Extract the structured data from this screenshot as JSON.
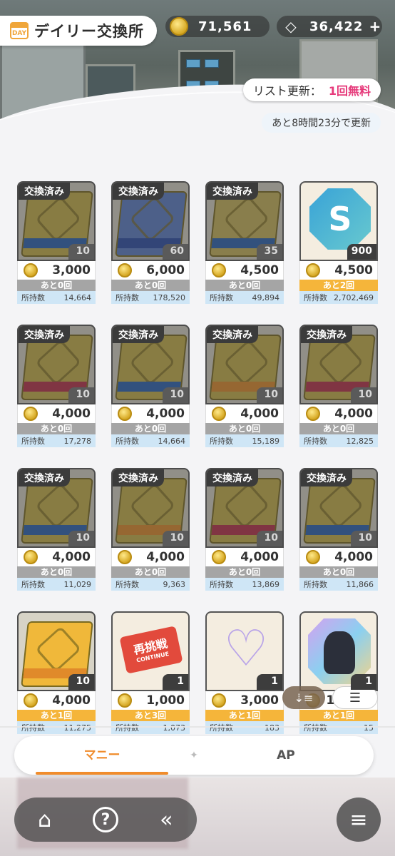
{
  "header": {
    "title": "デイリー交換所",
    "day_icon_label": "DAY",
    "coins": "71,561",
    "gems": "36,422",
    "gems_plus": "+",
    "refresh_label": "リスト更新：",
    "refresh_value": "1回無料",
    "timer": "あと8時間23分で更新"
  },
  "labels": {
    "done_badge": "交換済み",
    "own_label": "所持数"
  },
  "items": [
    {
      "kind": "book",
      "count": "10",
      "price": "3,000",
      "remain": "あと0回",
      "owned": "14,664",
      "done": true,
      "color": "#c7b14a",
      "band": "#2b63b4"
    },
    {
      "kind": "book",
      "count": "60",
      "price": "6,000",
      "remain": "あと0回",
      "owned": "178,520",
      "done": true,
      "color": "#5b7ec9",
      "band": "#2b4ea8"
    },
    {
      "kind": "book",
      "count": "35",
      "price": "4,500",
      "remain": "あと0回",
      "owned": "49,894",
      "done": true,
      "color": "#c9b559",
      "band": "#2a63b2"
    },
    {
      "kind": "special-s",
      "count": "900",
      "price": "4,500",
      "remain": "あと2回",
      "owned": "2,702,469",
      "done": false,
      "icon_text": "S"
    },
    {
      "kind": "book",
      "count": "10",
      "price": "4,000",
      "remain": "あと0回",
      "owned": "17,278",
      "done": true,
      "color": "#c7b14a",
      "band": "#b8304a"
    },
    {
      "kind": "book",
      "count": "10",
      "price": "4,000",
      "remain": "あと0回",
      "owned": "14,664",
      "done": true,
      "color": "#c7b14a",
      "band": "#2b63b4"
    },
    {
      "kind": "book",
      "count": "10",
      "price": "4,000",
      "remain": "あと0回",
      "owned": "15,189",
      "done": true,
      "color": "#c7b14a",
      "band": "#e08a2a"
    },
    {
      "kind": "book",
      "count": "10",
      "price": "4,000",
      "remain": "あと0回",
      "owned": "12,825",
      "done": true,
      "color": "#c7b14a",
      "band": "#b8304a"
    },
    {
      "kind": "book",
      "count": "10",
      "price": "4,000",
      "remain": "あと0回",
      "owned": "11,029",
      "done": true,
      "color": "#c7b14a",
      "band": "#2b63b4"
    },
    {
      "kind": "book",
      "count": "10",
      "price": "4,000",
      "remain": "あと0回",
      "owned": "9,363",
      "done": true,
      "color": "#c7b14a",
      "band": "#e08a2a"
    },
    {
      "kind": "book",
      "count": "10",
      "price": "4,000",
      "remain": "あと0回",
      "owned": "13,869",
      "done": true,
      "color": "#c7b14a",
      "band": "#b8304a"
    },
    {
      "kind": "book",
      "count": "10",
      "price": "4,000",
      "remain": "あと0回",
      "owned": "11,866",
      "done": true,
      "color": "#c7b14a",
      "band": "#2b63b4"
    },
    {
      "kind": "book",
      "count": "10",
      "price": "4,000",
      "remain": "あと1回",
      "owned": "11,275",
      "done": false,
      "color": "#f0b83a",
      "band": "#e08a2a"
    },
    {
      "kind": "ticket",
      "count": "1",
      "price": "1,000",
      "remain": "あと3回",
      "owned": "1,073",
      "done": false,
      "ticket_text": "再挑戦",
      "ticket_sub": "CONTINUE"
    },
    {
      "kind": "key",
      "count": "1",
      "price": "3,000",
      "remain": "あと1回",
      "owned": "183",
      "done": false
    },
    {
      "kind": "portrait",
      "count": "1",
      "price": "12,000",
      "remain": "あと1回",
      "owned": "15",
      "done": false
    }
  ],
  "tabs": [
    {
      "label": "マニー",
      "active": true
    },
    {
      "label": "AP",
      "active": false
    }
  ],
  "tab_separator": "✦",
  "icons": {
    "coin": "coin-icon",
    "gem": "gem-icon",
    "sort": "sort-icon",
    "layout": "layout-toggle-icon",
    "home": "home-icon",
    "help": "help-icon",
    "back": "back-icon",
    "menu": "menu-icon"
  },
  "colors": {
    "accent": "#f08c2b",
    "free": "#e6397a",
    "remain_active": "#f5b53a",
    "remain_done": "#a5a5a5",
    "own_bg": "#cfe6f6"
  }
}
